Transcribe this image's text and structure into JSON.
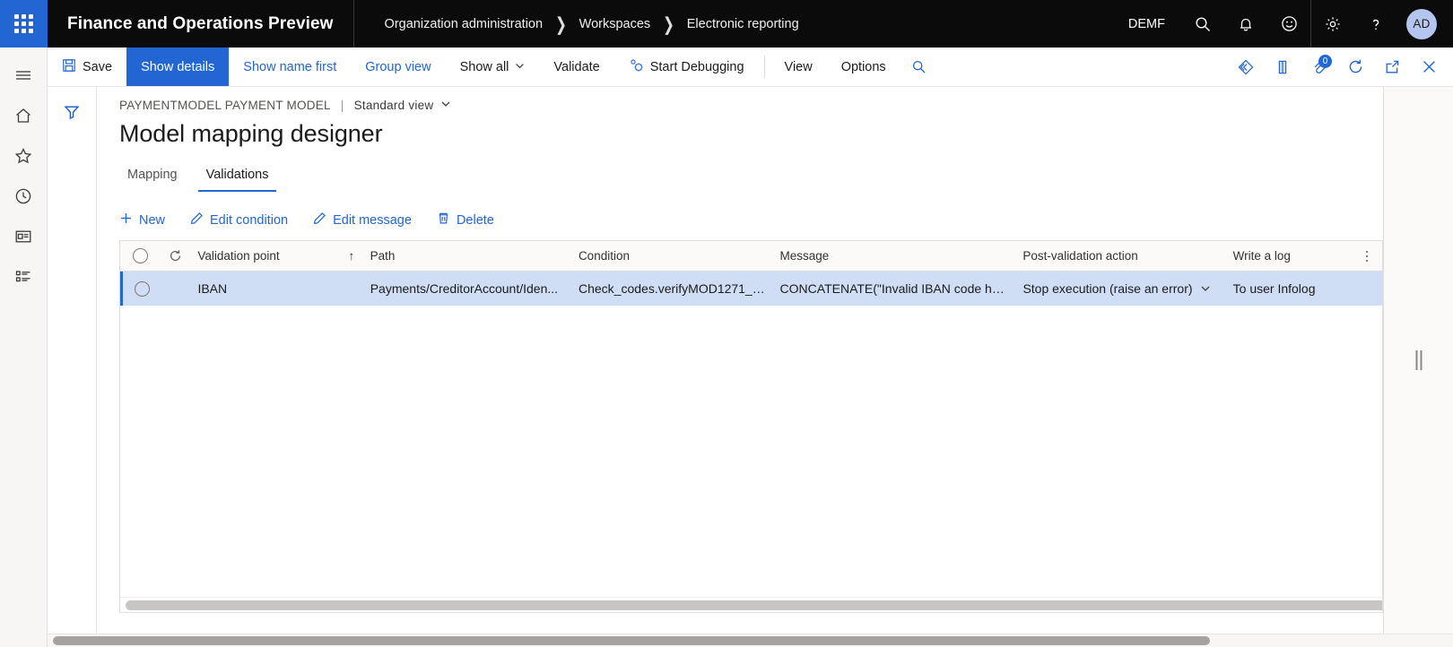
{
  "header": {
    "app_title": "Finance and Operations Preview",
    "waffle_icon": "app-launcher-icon",
    "breadcrumb": [
      "Organization administration",
      "Workspaces",
      "Electronic reporting"
    ],
    "company": "DEMF",
    "icons": [
      "search-icon",
      "notifications-bell-icon",
      "feedback-smiley-icon",
      "settings-gear-icon",
      "help-question-icon"
    ],
    "avatar_initials": "AD"
  },
  "leftrail": {
    "items": [
      "hamburger-menu-icon",
      "home-icon",
      "favorites-star-icon",
      "recent-clock-icon",
      "workspaces-icon",
      "modules-list-icon"
    ]
  },
  "commandbar": {
    "save": "Save",
    "show_details": "Show details",
    "show_name_first": "Show name first",
    "group_view": "Group view",
    "show_all": "Show all",
    "validate": "Validate",
    "start_debugging": "Start Debugging",
    "view": "View",
    "options": "Options",
    "search_icon": "search-icon",
    "right_icons": [
      "personalize-diamond-icon",
      "office-app-icon",
      "attachments-icon",
      "refresh-icon",
      "open-in-new-window-icon",
      "close-icon"
    ],
    "attachment_count": "0"
  },
  "page": {
    "filter_icon": "filter-funnel-icon",
    "caption": "PAYMENTMODEL PAYMENT MODEL",
    "caption_separator": "|",
    "view_name": "Standard view",
    "title": "Model mapping designer",
    "tabs": [
      {
        "label": "Mapping",
        "active": false
      },
      {
        "label": "Validations",
        "active": true
      }
    ],
    "actions": [
      {
        "label": "New",
        "icon": "plus-icon"
      },
      {
        "label": "Edit condition",
        "icon": "pencil-edit-icon"
      },
      {
        "label": "Edit message",
        "icon": "pencil-edit-icon"
      },
      {
        "label": "Delete",
        "icon": "trash-delete-icon"
      }
    ]
  },
  "grid": {
    "select_all_icon": "select-all-circle-icon",
    "refresh_icon": "refresh-column-icon",
    "sort_indicator": "↑",
    "overflow_icon": "more-vertical-icon",
    "columns": [
      "Validation point",
      "Path",
      "Condition",
      "Message",
      "Post-validation action",
      "Write a log"
    ],
    "rows": [
      {
        "validation_point": "IBAN",
        "path": "Payments/CreditorAccount/Iden...",
        "condition": "Check_codes.verifyMOD1271_3...",
        "message": "CONCATENATE(\"Invalid IBAN code ha...",
        "post_validation_action": "Stop execution (raise an error)",
        "write_a_log": "To user Infolog",
        "selected": true
      }
    ]
  },
  "colors": {
    "accent": "#2266d3",
    "header_bg": "#0b0b0b",
    "row_selected": "#cfddf5",
    "avatar_bg": "#b4c6ef"
  }
}
